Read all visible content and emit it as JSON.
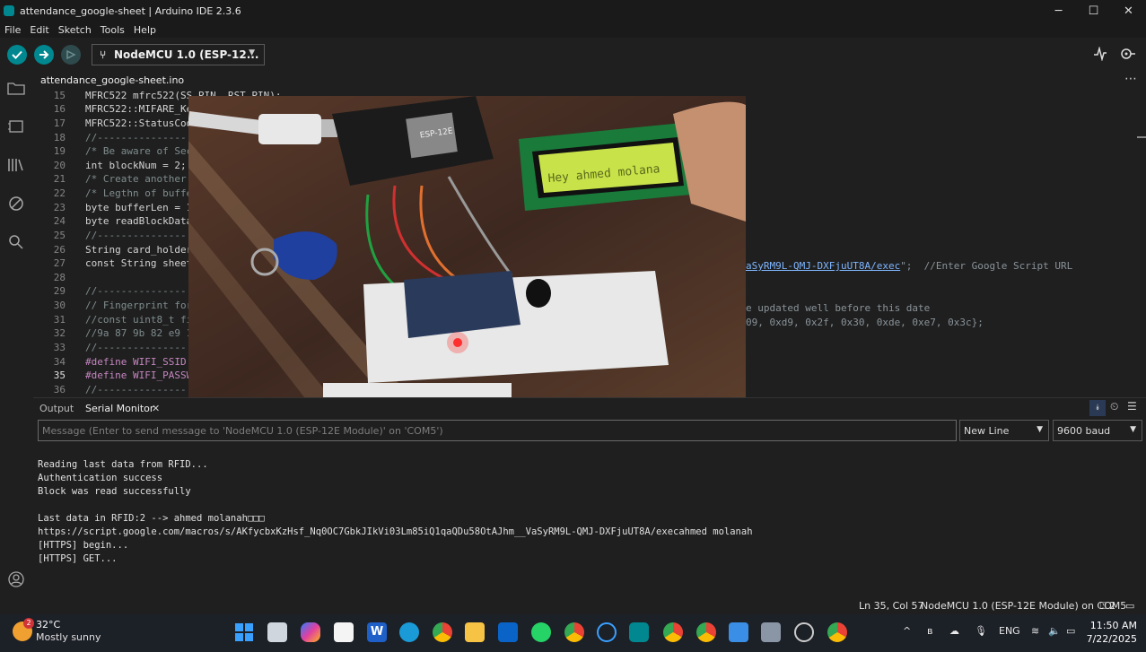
{
  "window": {
    "title": "attendance_google-sheet | Arduino IDE 2.3.6",
    "minimize": "─",
    "maximize": "☐",
    "close": "✕"
  },
  "menu": [
    "File",
    "Edit",
    "Sketch",
    "Tools",
    "Help"
  ],
  "toolbar": {
    "board": "NodeMCU 1.0 (ESP-12..."
  },
  "tab": {
    "file": "attendance_google-sheet.ino"
  },
  "editor": {
    "lines": [
      {
        "n": "15",
        "text": "MFRC522 mfrc522(SS_PIN, RST_PIN);"
      },
      {
        "n": "16",
        "text": "MFRC522::MIFARE_Ke"
      },
      {
        "n": "17",
        "text": "MFRC522::StatusCod"
      },
      {
        "n": "18",
        "text": "//---------------"
      },
      {
        "n": "19",
        "text": "/* Be aware of Sec"
      },
      {
        "n": "20",
        "text": "int blockNum = 2;"
      },
      {
        "n": "21",
        "text": "/* Create another"
      },
      {
        "n": "22",
        "text": "/* Legthn of buffe"
      },
      {
        "n": "23",
        "text": "byte bufferLen = 1"
      },
      {
        "n": "24",
        "text": "byte readBlockData"
      },
      {
        "n": "25",
        "text": "//---------------"
      },
      {
        "n": "26",
        "text": "String card_holder"
      },
      {
        "n": "27",
        "text": "const String sheet"
      },
      {
        "n": "28",
        "text": ""
      },
      {
        "n": "29",
        "text": "//---------------"
      },
      {
        "n": "30",
        "text": "// Fingerprint for"
      },
      {
        "n": "31",
        "text": "//const uint8_t fi"
      },
      {
        "n": "32",
        "text": "//9a 87 9b 82 e9 1"
      },
      {
        "n": "33",
        "text": "//---------------"
      },
      {
        "n": "34",
        "text": "#define WIFI_SSID"
      },
      {
        "n": "35",
        "text": "#define WIFI_PASSW"
      },
      {
        "n": "36",
        "text": "//---------------"
      }
    ],
    "right_url": "aSyRM9L-QMJ-DXFjuUT8A/exec",
    "right_url_tail": "\";  //Enter Google Script URL",
    "right_30": "e updated well before this date",
    "right_31": "09, 0xd9, 0x2f, 0x30, 0xde, 0xe7, 0x3c};"
  },
  "photo": {
    "lcd_text": "Hey ahmed molana",
    "module_label": "ESP-12E"
  },
  "panel": {
    "output_tab": "Output",
    "serial_tab": "Serial Monitor",
    "serial_close": "✕",
    "input_placeholder": "Message (Enter to send message to 'NodeMCU 1.0 (ESP-12E Module)' on 'COM5')",
    "line_ending": "New Line",
    "baud": "9600 baud",
    "output": [
      "Reading last data from RFID...",
      "Authentication success",
      "Block was read successfully",
      "",
      "Last data in RFID:2 --> ahmed molanah□□□",
      "https://script.google.com/macros/s/AKfycbxKzHsf_Nq0OC7GbkJIkVi03Lm85iQ1qaQDu58OtAJhm__VaSyRM9L-QMJ-DXFjuUT8A/execahmed molanah",
      "[HTTPS] begin...",
      "[HTTPS] GET..."
    ]
  },
  "status": {
    "position": "Ln 35, Col 57",
    "board": "NodeMCU 1.0 (ESP-12E Module) on COM5",
    "notifications": "2"
  },
  "taskbar": {
    "weather_temp": "32°C",
    "weather_desc": "Mostly sunny",
    "weather_badge": "2",
    "lang": "ENG",
    "time": "11:50 AM",
    "date": "7/22/2025"
  },
  "colors": {
    "verify": "#00878f",
    "upload": "#00878f",
    "accent": "#00878f"
  }
}
